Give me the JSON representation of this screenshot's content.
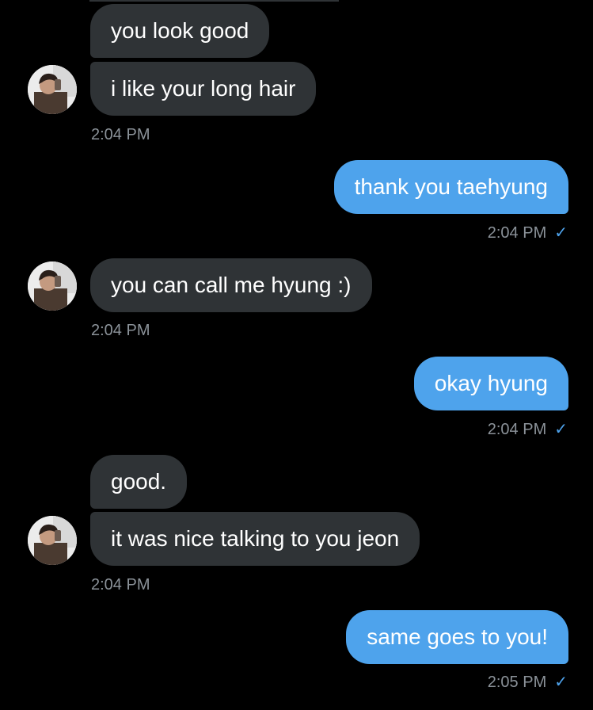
{
  "colors": {
    "background": "#000000",
    "received_bubble": "#2f3336",
    "sent_bubble": "#4ea3ec",
    "timestamp": "#8b9299",
    "read_check": "#4ea3ec"
  },
  "messages": [
    {
      "direction": "received",
      "text": "you look good"
    },
    {
      "direction": "received",
      "text": "i like your long hair"
    },
    {
      "direction": "received_time",
      "time": "2:04 PM"
    },
    {
      "direction": "sent",
      "text": "thank you taehyung"
    },
    {
      "direction": "sent_time",
      "time": "2:04 PM",
      "status_icon": "read-check-icon"
    },
    {
      "direction": "received",
      "text": "you can call me hyung :)"
    },
    {
      "direction": "received_time",
      "time": "2:04 PM"
    },
    {
      "direction": "sent",
      "text": "okay hyung"
    },
    {
      "direction": "sent_time",
      "time": "2:04 PM",
      "status_icon": "read-check-icon"
    },
    {
      "direction": "received",
      "text": "good."
    },
    {
      "direction": "received",
      "text": "it was nice talking to you jeon"
    },
    {
      "direction": "received_time",
      "time": "2:04 PM"
    },
    {
      "direction": "sent",
      "text": "same goes to you!"
    },
    {
      "direction": "sent_time",
      "time": "2:05 PM",
      "status_icon": "read-check-icon"
    }
  ],
  "check_glyph": "✓"
}
